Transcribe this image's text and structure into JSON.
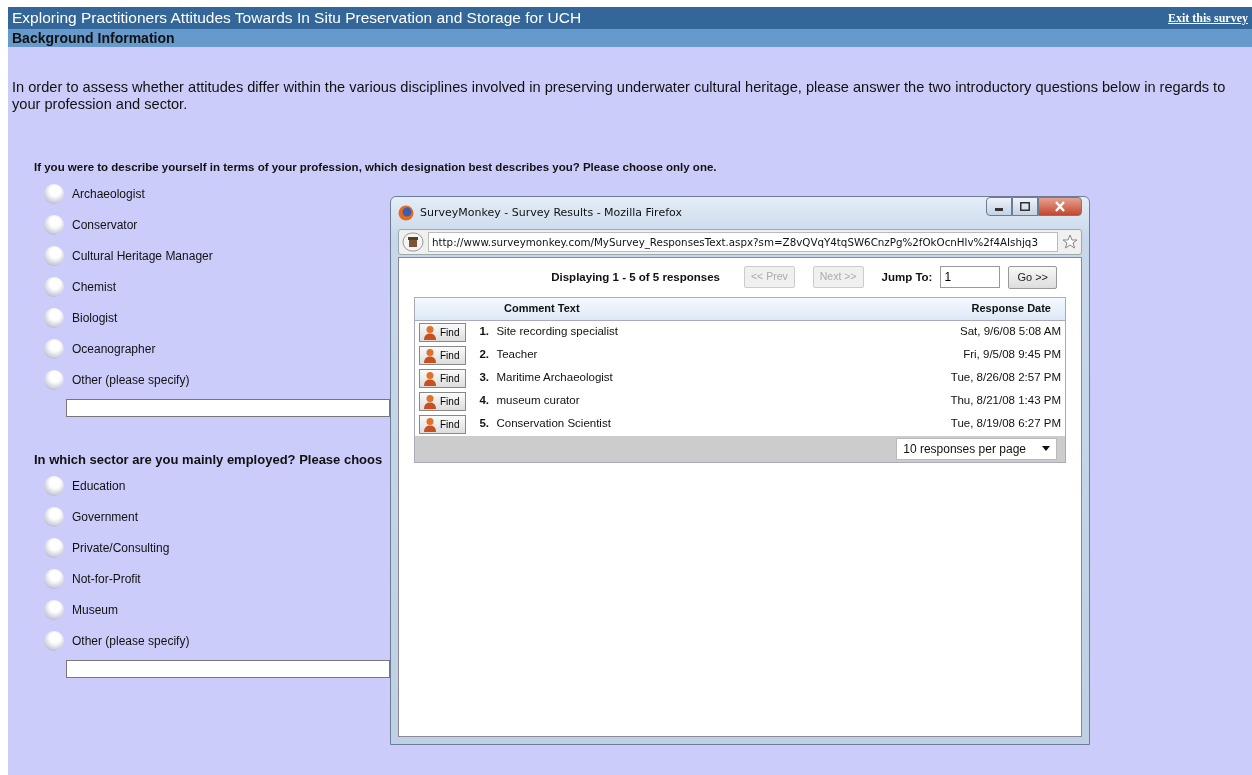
{
  "survey": {
    "title": "Exploring Practitioners Attitudes Towards In Situ Preservation and Storage for UCH",
    "exit_link": "Exit this survey",
    "section": "Background Information",
    "intro": "In order to assess whether attitudes differ within the various disciplines involved in preserving underwater cultural heritage, please answer the two introductory questions below in regards to your profession and sector.",
    "questions": [
      {
        "text": "If you were to describe yourself in terms of your profession, which designation best describes you? Please choose only one.",
        "other_field": true,
        "options": [
          {
            "label": "Archaeologist",
            "selected": false
          },
          {
            "label": "Conservator",
            "selected": false
          },
          {
            "label": "Cultural Heritage Manager",
            "selected": false
          },
          {
            "label": "Chemist",
            "selected": false
          },
          {
            "label": "Biologist",
            "selected": false
          },
          {
            "label": "Oceanographer",
            "selected": false
          },
          {
            "label": "Other (please specify)",
            "selected": false
          }
        ]
      },
      {
        "text": "In which sector are you mainly employed? Please choos",
        "other_field": true,
        "options": [
          {
            "label": "Education",
            "selected": false
          },
          {
            "label": "Government",
            "selected": false
          },
          {
            "label": "Private/Consulting",
            "selected": false
          },
          {
            "label": "Not-for-Profit",
            "selected": false
          },
          {
            "label": "Museum",
            "selected": false
          },
          {
            "label": "Other (please specify)",
            "selected": false
          }
        ]
      }
    ]
  },
  "popup": {
    "window_title": "SurveyMonkey - Survey Results - Mozilla Firefox",
    "url": "http://www.surveymonkey.com/MySurvey_ResponsesText.aspx?sm=Z8vQVqY4tqSW6CnzPg%2fOkOcnHlv%2f4AIshjq3",
    "pagination": {
      "summary": "Displaying 1 - 5 of 5 responses",
      "prev": {
        "label": "<< Prev",
        "disabled": true
      },
      "next": {
        "label": "Next >>",
        "disabled": true
      },
      "jump_label": "Jump To:",
      "jump_value": "1",
      "go": {
        "label": "Go >>",
        "disabled": false
      }
    },
    "columns": [
      "Comment Text",
      "Response Date"
    ],
    "rows": [
      {
        "button": "Find",
        "number": "1.",
        "text": "Site recording specialist",
        "date": "Sat, 9/6/08 5:08 AM"
      },
      {
        "button": "Find",
        "number": "2.",
        "text": "Teacher",
        "date": "Fri, 9/5/08 9:45 PM"
      },
      {
        "button": "Find",
        "number": "3.",
        "text": "Maritime Archaeologist",
        "date": "Tue, 8/26/08 2:57 PM"
      },
      {
        "button": "Find",
        "number": "4.",
        "text": "museum curator",
        "date": "Thu, 8/21/08 1:43 PM"
      },
      {
        "button": "Find",
        "number": "5.",
        "text": "Conservation Scientist",
        "date": "Tue, 8/19/08 6:27 PM"
      }
    ],
    "per_page": "10 responses per page"
  }
}
